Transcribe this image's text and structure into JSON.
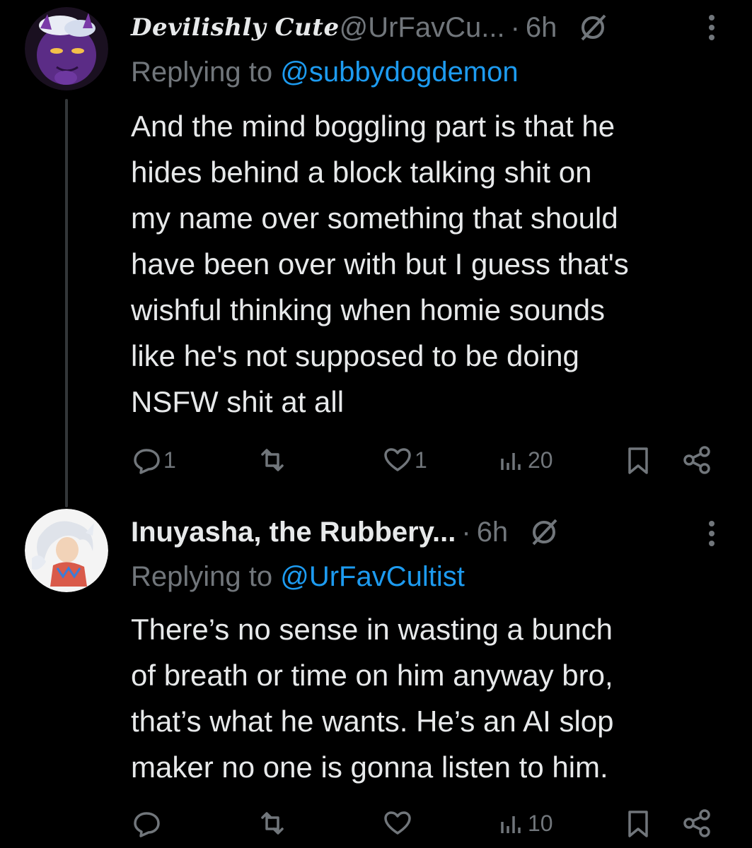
{
  "tweets": [
    {
      "display_name": "Devilishly Cute",
      "handle": "@UrFavCu...",
      "separator": "·",
      "time": "6h",
      "replying_prefix": "Replying to ",
      "replying_to": "@subbydogdemon",
      "text": "And the mind boggling part is that he\nhides behind a block talking shit on\nmy name over something that should\nhave been over with but I guess that's\nwishful thinking when homie sounds\nlike he's not supposed to be doing\nNSFW shit at all",
      "replies": "1",
      "reposts": "",
      "likes": "1",
      "views": "20",
      "avatar_bg": "#5a2a80"
    },
    {
      "display_name": "Inuyasha, the Rubbery...",
      "handle": "",
      "separator": "·",
      "time": "6h",
      "replying_prefix": "Replying to ",
      "replying_to": "@UrFavCultist",
      "text": "There’s no sense in wasting a bunch\nof breath or time on him anyway bro,\nthat’s what he wants. He’s an AI slop\nmaker no one is gonna listen to him.",
      "replies": "",
      "reposts": "",
      "likes": "",
      "views": "10",
      "avatar_bg": "#f4f4f4"
    }
  ],
  "icons": {
    "bot": "bot-label-icon",
    "more": "more-options-icon",
    "reply": "reply-icon",
    "repost": "repost-icon",
    "like": "like-icon",
    "views": "views-icon",
    "bookmark": "bookmark-icon",
    "share": "share-icon"
  },
  "colors": {
    "background": "#000000",
    "text": "#e7e9ea",
    "muted": "#71767b",
    "link": "#1d9bf0",
    "thread_line": "#333639"
  }
}
